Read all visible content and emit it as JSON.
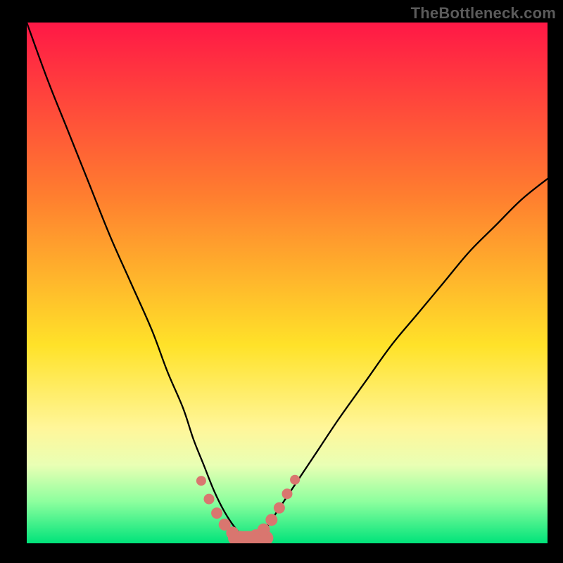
{
  "watermark": "TheBottleneck.com",
  "chart_data": {
    "type": "line",
    "title": "",
    "xlabel": "",
    "ylabel": "",
    "xlim": [
      0,
      100
    ],
    "ylim": [
      0,
      100
    ],
    "grid": false,
    "legend": false,
    "gradient_stops": [
      {
        "offset": 0.0,
        "color": "#ff1846"
      },
      {
        "offset": 0.33,
        "color": "#ff7d2f"
      },
      {
        "offset": 0.62,
        "color": "#ffe229"
      },
      {
        "offset": 0.78,
        "color": "#fff69a"
      },
      {
        "offset": 0.85,
        "color": "#e9ffb4"
      },
      {
        "offset": 0.92,
        "color": "#8dff9e"
      },
      {
        "offset": 1.0,
        "color": "#00e37a"
      }
    ],
    "series": [
      {
        "name": "bottleneck-curve",
        "x": [
          0,
          4,
          8,
          12,
          16,
          20,
          24,
          27,
          30,
          32,
          34,
          36,
          38,
          40,
          42,
          44,
          46,
          48,
          52,
          56,
          60,
          65,
          70,
          75,
          80,
          85,
          90,
          95,
          100
        ],
        "y": [
          100,
          89,
          79,
          69,
          59,
          50,
          41,
          33,
          26,
          20,
          15,
          10,
          6,
          3,
          1,
          1,
          3,
          6,
          12,
          18,
          24,
          31,
          38,
          44,
          50,
          56,
          61,
          66,
          70
        ]
      }
    ],
    "markers": {
      "name": "highlight-points",
      "x": [
        33.5,
        35,
        36.5,
        38,
        39.5,
        41,
        42.5,
        44,
        45.5,
        47,
        48.5,
        50,
        51.5
      ],
      "y": [
        12,
        8.5,
        5.8,
        3.6,
        2.0,
        1.1,
        1.0,
        1.4,
        2.6,
        4.5,
        6.8,
        9.5,
        12.2
      ]
    },
    "min_region": {
      "x_start": 40,
      "x_end": 46,
      "y": 1
    }
  }
}
